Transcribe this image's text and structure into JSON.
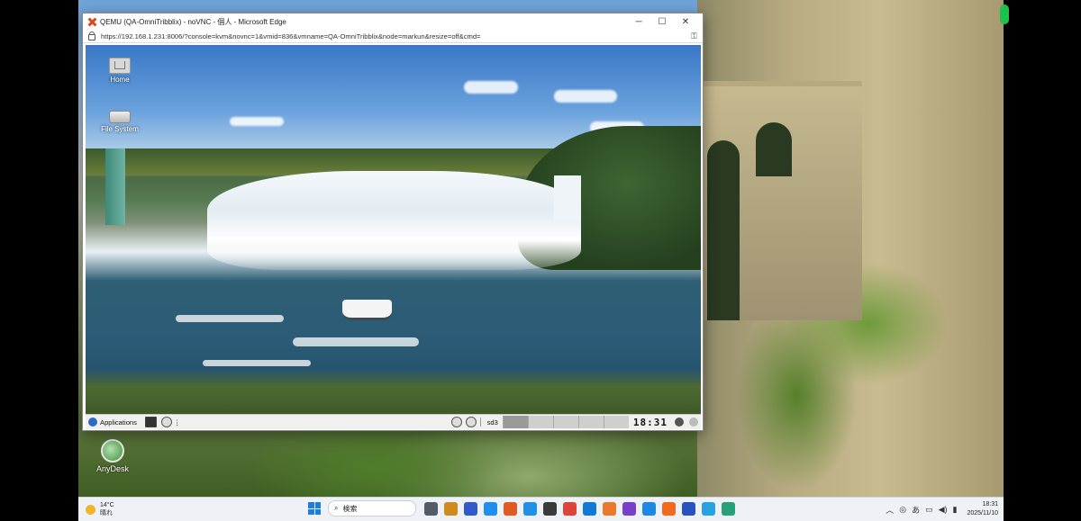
{
  "browser": {
    "title": "QEMU (QA-OmniTribblix) - noVNC - 個人 - Microsoft Edge",
    "url": "https://192.168.1.231:8006/?console=kvm&novnc=1&vmid=836&vmname=QA-OmniTribblix&node=markun&resize=off&cmd=",
    "minimize": "─",
    "maximize": "☐",
    "close": "✕",
    "key_icon": "⚿"
  },
  "guest_desktop": {
    "icons": [
      {
        "label": "Home",
        "icon": "home-folder-icon"
      },
      {
        "label": "File System",
        "icon": "drive-icon"
      }
    ]
  },
  "guest_panel": {
    "applications_label": "Applications",
    "workspace_label": "sd3",
    "clock": "18:31",
    "menu_dots": "⋮"
  },
  "host_desktop": {
    "icon_label": "AnyDesk"
  },
  "taskbar": {
    "temperature": "14°C",
    "condition": "晴れ",
    "search_placeholder": "検索",
    "time": "18:31",
    "date": "2025/11/10",
    "pinned_colors": [
      "#555b66",
      "#d18a1c",
      "#2f5cc8",
      "#1e8ef0",
      "#e05a21",
      "#1f8fe8",
      "#3a3a3a",
      "#db4437",
      "#0f7bd6",
      "#e97a2c",
      "#7a3fc9",
      "#1e88e5",
      "#f26b1d",
      "#2a52be",
      "#2aa1e0",
      "#28a17a"
    ]
  }
}
